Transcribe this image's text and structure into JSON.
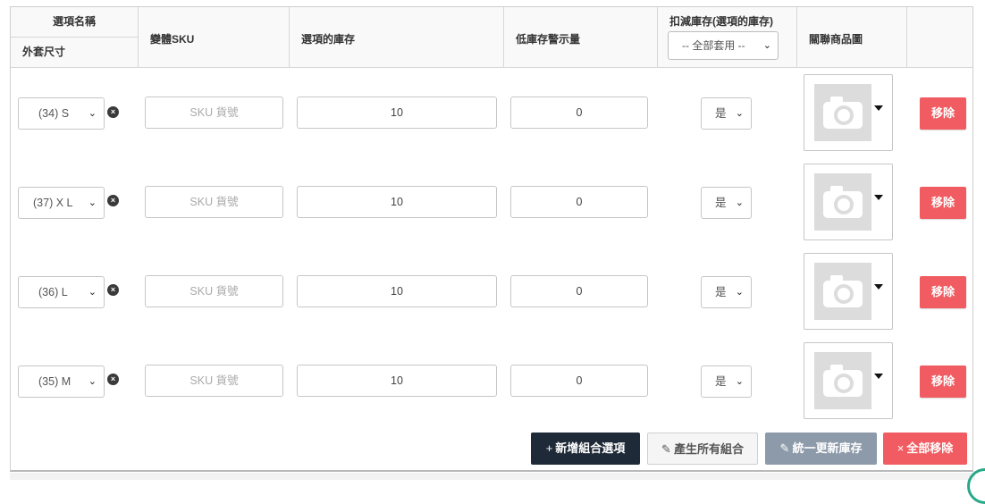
{
  "header": {
    "option_name": "選項名稱",
    "option_sub": "外套尺寸",
    "variant_sku": "變體SKU",
    "stock": "選項的庫存",
    "low_stock": "低庫存警示量",
    "deduct": "扣減庫存(選項的庫存)",
    "deduct_select": "-- 全部套用 --",
    "image": "關聯商品圖"
  },
  "rows": [
    {
      "option": "(34) S",
      "sku_placeholder": "SKU 貨號",
      "stock": "10",
      "low_stock": "0",
      "deduct": "是",
      "remove": "移除"
    },
    {
      "option": "(37) X L",
      "sku_placeholder": "SKU 貨號",
      "stock": "10",
      "low_stock": "0",
      "deduct": "是",
      "remove": "移除"
    },
    {
      "option": "(36) L",
      "sku_placeholder": "SKU 貨號",
      "stock": "10",
      "low_stock": "0",
      "deduct": "是",
      "remove": "移除"
    },
    {
      "option": "(35) M",
      "sku_placeholder": "SKU 貨號",
      "stock": "10",
      "low_stock": "0",
      "deduct": "是",
      "remove": "移除"
    }
  ],
  "footer": {
    "add_label": "新增組合選項",
    "add_icon": "+",
    "generate_label": "產生所有組合",
    "generate_icon": "✎",
    "update_label": "統一更新庫存",
    "update_icon": "✎",
    "remove_all_label": "全部移除",
    "remove_all_icon": "×"
  },
  "colors": {
    "remove_red": "#f05c61",
    "dark_button": "#1f2a38",
    "slate_button": "#8d9aaa"
  },
  "icons": {
    "clear": "x-circle-icon",
    "camera": "camera-placeholder-icon",
    "chevron": "chevron-down-icon"
  }
}
